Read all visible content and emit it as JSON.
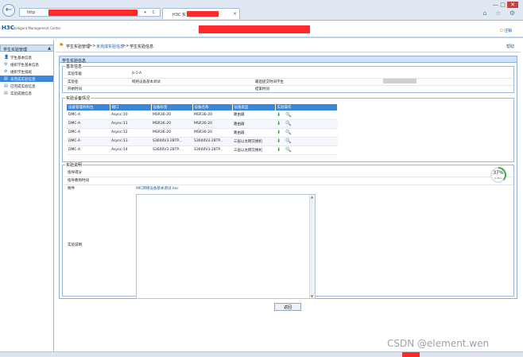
{
  "browser": {
    "address_prefix": "http",
    "address_controls": "ρ ▾ C",
    "tab_title": "H3C 实",
    "window_controls": [
      "—",
      "□",
      "✕"
    ],
    "right_glyphs": "⌂ ☆ ⚙"
  },
  "header": {
    "logo": "H3C",
    "logo_sub": "Intelligent Management Center",
    "title_prefix": "·",
    "logout": "注销"
  },
  "sidebar": {
    "title": "学生实验管理",
    "items": [
      {
        "label": "学生基本信息"
      },
      {
        "label": "组织学生基本信息"
      },
      {
        "label": "组织学生排班"
      },
      {
        "label": "未完成实验信息"
      },
      {
        "label": "已完成实验信息"
      },
      {
        "label": "实验成绩信息"
      }
    ]
  },
  "breadcrumb": {
    "level1": "学生实验管理",
    "level2": "未完成实验信息",
    "level3": "学生实验信息",
    "separator": ">>"
  },
  "help": "帮助",
  "panel": {
    "title": "学生实验信息",
    "basic": {
      "legend": "基本信息",
      "fields": [
        {
          "label": "实验年级",
          "value": "jt-1-A"
        },
        {
          "label": "实验名",
          "value": "网络设备基本调试"
        },
        {
          "label": "开始时间",
          "value": ""
        },
        {
          "label": "最后提交时间学生",
          "value": ""
        },
        {
          "label": "结束时间",
          "value": ""
        }
      ]
    },
    "devices": {
      "legend": "实验设备情况",
      "columns": [
        "设备管理机构台",
        "端口",
        "设备标签",
        "设备名称",
        "设备类型",
        "实验操作"
      ],
      "rows": [
        [
          "DMC-A",
          "Async:10",
          "MSR36-20",
          "MSR36-20",
          "路由器"
        ],
        [
          "DMC-A",
          "Async:11",
          "MSR36-20",
          "MSR36-20",
          "路由器"
        ],
        [
          "DMC-A",
          "Async:12",
          "MSR36-20",
          "MSR36-20",
          "路由器"
        ],
        [
          "DMC-A",
          "Async:13",
          "S3600V3-28TP...",
          "S3600V3-28TP...",
          "三层以太网交换机"
        ],
        [
          "DMC-A",
          "Async:14",
          "S3600V3-28TP...",
          "S3600V3-28TP...",
          "三层以太网交换机"
        ]
      ]
    },
    "explain": {
      "legend": "实验说明",
      "score_label": "指导得分",
      "time_label": "指导教师时间",
      "attachment_label": "附件",
      "attachment_value": "IMC网络设备基本调试.doc",
      "desc_label": "实验说明"
    },
    "return_button": "返回"
  },
  "progress": {
    "percent": 37,
    "label": "37%",
    "sub": "0.4K/s"
  },
  "watermark": "CSDN @element.wen",
  "colors": {
    "accent": "#3c86d8",
    "redact": "#ff2a2a"
  }
}
